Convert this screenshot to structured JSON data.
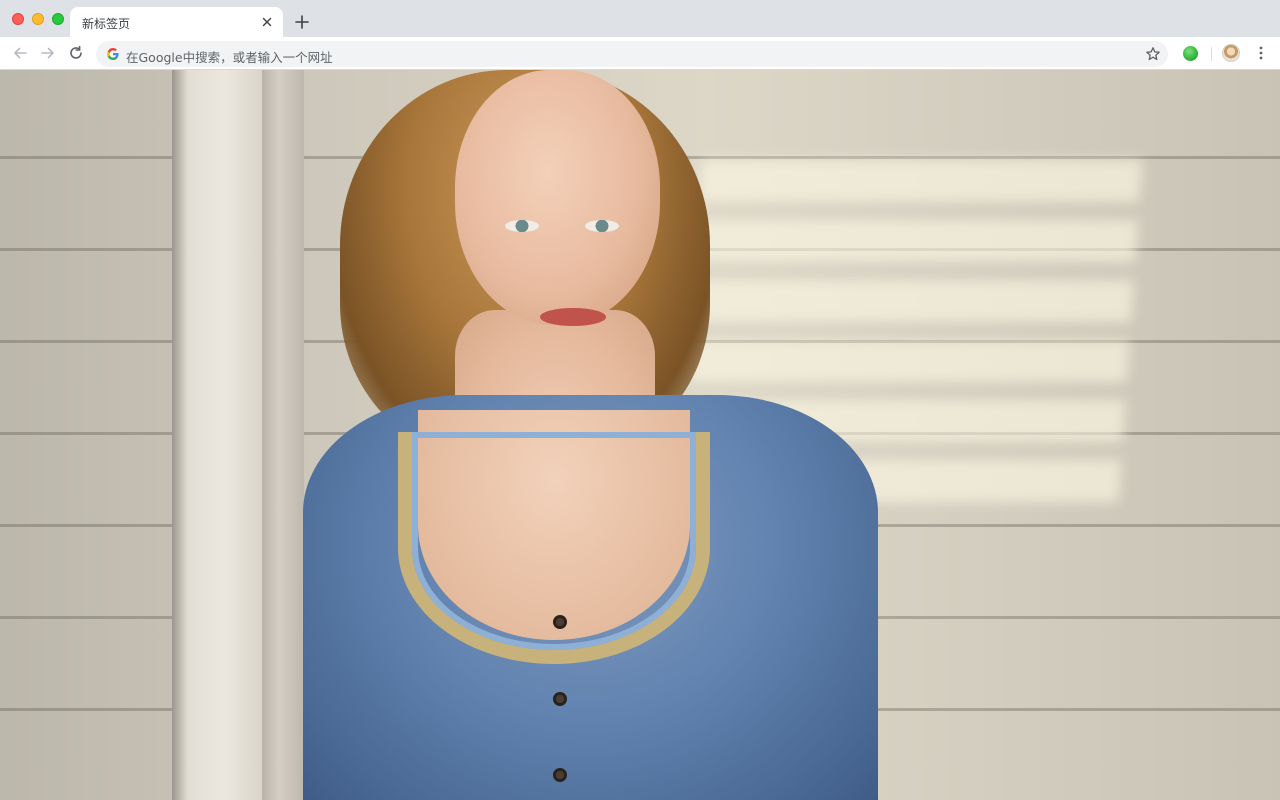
{
  "window": {
    "tab_title": "新标签页",
    "new_tab_label": "+"
  },
  "toolbar": {
    "omnibox_placeholder": "在Google中搜索，或者输入一个网址"
  },
  "colors": {
    "tabstrip_bg": "#dee1e6",
    "toolbar_bg": "#ffffff",
    "omnibox_bg": "#f1f3f4",
    "icon_gray": "#5f6368"
  },
  "icons": {
    "back": "arrow-left-icon",
    "forward": "arrow-right-icon",
    "reload": "reload-icon",
    "search_engine": "google-g-icon",
    "bookmark": "star-icon",
    "extension": "green-circle-extension-icon",
    "profile": "avatar-icon",
    "menu": "three-dots-vertical-icon"
  }
}
